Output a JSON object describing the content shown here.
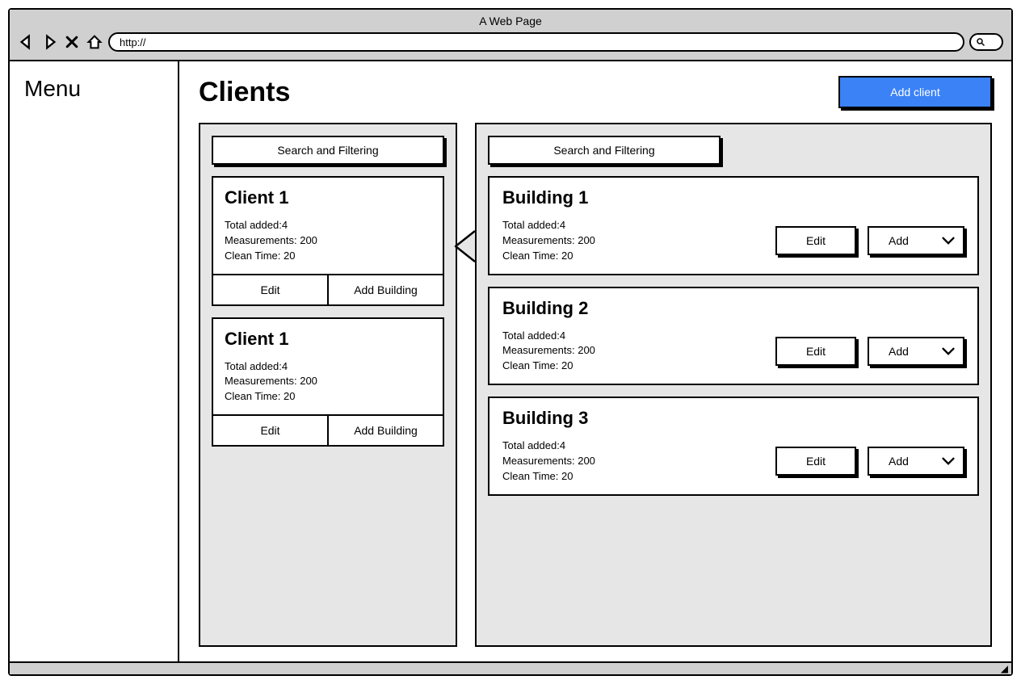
{
  "browser": {
    "title": "A Web Page",
    "url": "http://"
  },
  "sidebar": {
    "menu_label": "Menu"
  },
  "header": {
    "page_title": "Clients",
    "add_client_label": "Add client"
  },
  "clients_panel": {
    "search_label": "Search and Filtering",
    "items": [
      {
        "name": "Client 1",
        "total_added_label": "Total added:",
        "total_added": "4",
        "measurements_label": "Measurements:",
        "measurements": "200",
        "clean_time_label": "Clean Time:",
        "clean_time": "20",
        "edit_label": "Edit",
        "add_building_label": "Add Building"
      },
      {
        "name": "Client 1",
        "total_added_label": "Total added:",
        "total_added": "4",
        "measurements_label": "Measurements:",
        "measurements": "200",
        "clean_time_label": "Clean Time:",
        "clean_time": "20",
        "edit_label": "Edit",
        "add_building_label": "Add Building"
      }
    ]
  },
  "buildings_panel": {
    "search_label": "Search and Filtering",
    "items": [
      {
        "name": "Building 1",
        "total_added_label": "Total added:",
        "total_added": "4",
        "measurements_label": "Measurements:",
        "measurements": "200",
        "clean_time_label": "Clean Time:",
        "clean_time": "20",
        "edit_label": "Edit",
        "add_label": "Add"
      },
      {
        "name": "Building 2",
        "total_added_label": "Total added:",
        "total_added": "4",
        "measurements_label": "Measurements:",
        "measurements": "200",
        "clean_time_label": "Clean Time:",
        "clean_time": "20",
        "edit_label": "Edit",
        "add_label": "Add"
      },
      {
        "name": "Building 3",
        "total_added_label": "Total added:",
        "total_added": "4",
        "measurements_label": "Measurements:",
        "measurements": "200",
        "clean_time_label": "Clean Time:",
        "clean_time": "20",
        "edit_label": "Edit",
        "add_label": "Add"
      }
    ]
  }
}
